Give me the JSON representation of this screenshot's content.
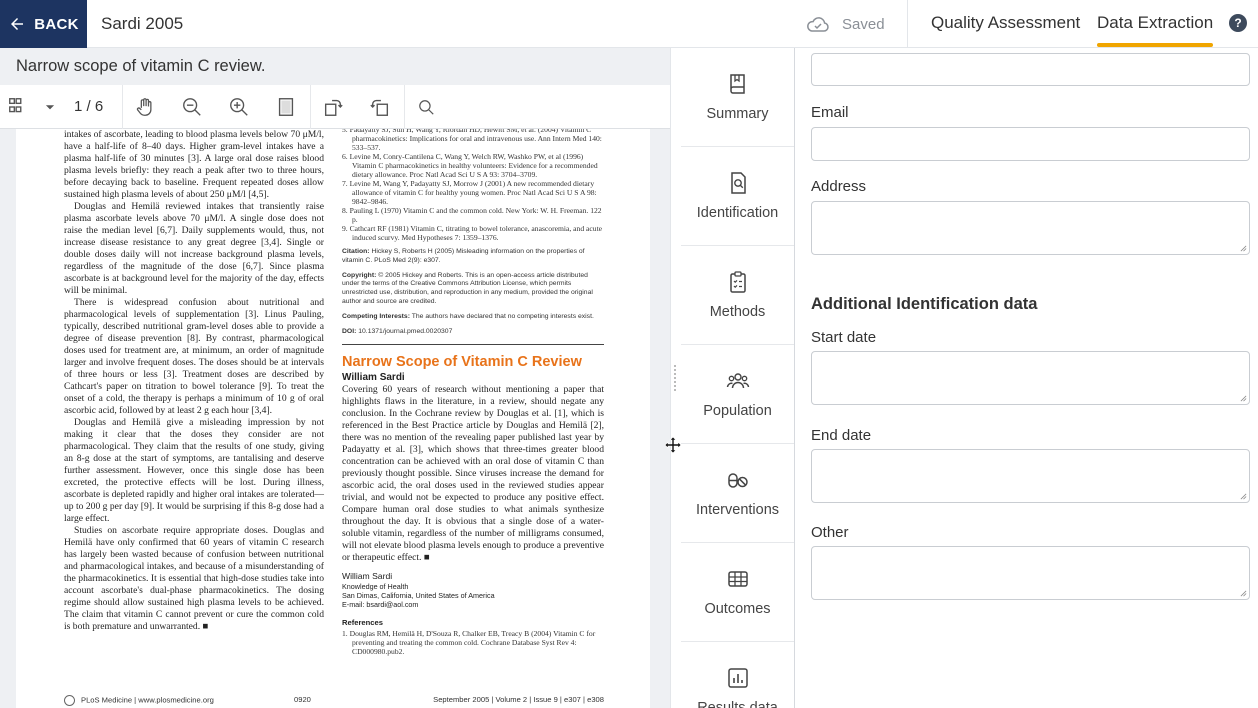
{
  "header": {
    "back_label": "BACK",
    "doc_title": "Sardi 2005",
    "saved_label": "Saved",
    "tabs": [
      {
        "label": "Quality Assessment"
      },
      {
        "label": "Data Extraction"
      }
    ],
    "help_label": "?"
  },
  "viewer": {
    "finding": "Narrow scope of vitamin C review.",
    "page_indicator": "1 / 6"
  },
  "document": {
    "col1": [
      "intakes of ascorbate, leading to blood plasma levels below 70 μM/l, have a half-life of 8–40 days. Higher gram-level intakes have a plasma half-life of 30 minutes [3]. A large oral dose raises blood plasma levels briefly: they reach a peak after two to three hours, before decaying back to baseline. Frequent repeated doses allow sustained high plasma levels of about 250 μM/l [4,5].",
      "Douglas and Hemilä reviewed intakes that transiently raise plasma ascorbate levels above 70 μM/l. A single dose does not raise the median level [6,7]. Daily supplements would, thus, not increase disease resistance to any great degree [3,4]. Single or double doses daily will not increase background plasma levels, regardless of the magnitude of the dose [6,7]. Since plasma ascorbate is at background level for the majority of the day, effects will be minimal.",
      "There is widespread confusion about nutritional and pharmacological levels of supplementation [3]. Linus Pauling, typically, described nutritional gram-level doses able to provide a degree of disease prevention [8]. By contrast, pharmacological doses used for treatment are, at minimum, an order of magnitude larger and involve frequent doses. The doses should be at intervals of three hours or less [3]. Treatment doses are described by Cathcart's paper on titration to bowel tolerance [9]. To treat the onset of a cold, the therapy is perhaps a minimum of 10 g of oral ascorbic acid, followed by at least 2 g each hour [3,4].",
      "Douglas and Hemilä give a misleading impression by not making it clear that the doses they consider are not pharmacological. They claim that the results of one study, giving an 8-g dose at the start of symptoms, are tantalising and deserve further assessment. However, once this single dose has been excreted, the protective effects will be lost. During illness, ascorbate is depleted rapidly and higher oral intakes are tolerated—up to 200 g per day [9]. It would be surprising if this 8-g dose had a large effect.",
      "Studies on ascorbate require appropriate doses. Douglas and Hemilä have only confirmed that 60 years of vitamin C research has largely been wasted because of confusion between nutritional and pharmacological intakes, and because of a misunderstanding of the pharmacokinetics. It is essential that high-dose studies take into account ascorbate's dual-phase pharmacokinetics. The dosing regime should allow sustained high plasma levels to be achieved. The claim that vitamin C cannot prevent or cure the common cold is both premature and unwarranted. ■"
    ],
    "refs_top": [
      "5.  Padayatty SJ, Sun H, Wang Y, Riordan HD, Hewitt SM, et al. (2004) Vitamin C pharmacokinetics: Implications for oral and intravenous use. Ann Intern Med 140: 533–537.",
      "6.  Levine M, Conry-Cantilena C, Wang Y, Welch RW, Washko PW, et al (1996) Vitamin C pharmacokinetics in healthy volunteers: Evidence for a recommended dietary allowance. Proc Natl Acad Sci U S A 93: 3704–3709.",
      "7.  Levine M, Wang Y, Padayatty SJ, Morrow J (2001) A new recommended dietary allowance of vitamin C for healthy young women. Proc Natl Acad Sci U S A 98: 9842–9846.",
      "8.  Pauling L (1970) Vitamin C and the common cold. New York: W. H. Freeman. 122 p.",
      "9.  Cathcart RF (1981) Vitamin C, titrating to bowel tolerance, anascoremia, and acute induced scurvy. Med Hypotheses 7: 1359–1376."
    ],
    "citation_label": "Citation:",
    "citation": " Hickey S, Roberts H (2005) Misleading information on the properties of vitamin C. PLoS Med 2(9): e307.",
    "copyright_label": "Copyright:",
    "copyright": " © 2005 Hickey and Roberts. This is an open-access article distributed under the terms of the Creative Commons Attribution License, which permits unrestricted use, distribution, and reproduction in any medium, provided the original author and source are credited.",
    "competing_label": "Competing Interests:",
    "competing": " The authors have declared that no competing interests exist.",
    "doi_label": "DOI:",
    "doi": " 10.1371/journal.pmed.0020307",
    "article_title": "Narrow Scope of Vitamin C Review",
    "article_author": "William Sardi",
    "article_body": "Covering 60 years of research without mentioning a paper that highlights flaws in the literature, in a review, should negate any conclusion. In the Cochrane review by Douglas et al. [1], which is referenced in the Best Practice article by Douglas and Hemilä [2], there was no mention of the revealing paper published last year by Padayatty et al. [3], which shows that three-times greater blood concentration can be achieved with an oral dose of vitamin C than previously thought possible. Since viruses increase the demand for ascorbic acid, the oral doses used in the reviewed studies appear trivial, and would not be expected to produce any positive effect. Compare human oral dose studies to what animals synthesize throughout the day. It is obvious that a single dose of a water-soluble vitamin, regardless of the number of milligrams consumed, will not elevate blood plasma levels enough to produce a preventive or therapeutic effect. ■",
    "addr_name": "William Sardi",
    "addr_org": "Knowledge of Health",
    "addr_city": "San Dimas, California, United States of America",
    "addr_email": "E-mail: bsardi@aol.com",
    "refs_head": "References",
    "ref1": "1.  Douglas RM, Hemilä H, D'Souza R, Chalker EB, Treacy B (2004) Vitamin C for preventing and treating the common cold. Cochrane Database Syst Rev 4: CD000980.pub2.",
    "footer_left": "PLoS Medicine  |  www.plosmedicine.org",
    "footer_mid": "0920",
    "footer_right": "September 2005  |  Volume 2  |  Issue 9  |  e307  |  e308"
  },
  "nav": {
    "items": [
      {
        "label": "Summary",
        "icon": "book-icon"
      },
      {
        "label": "Identification",
        "icon": "document-search-icon"
      },
      {
        "label": "Methods",
        "icon": "clipboard-icon"
      },
      {
        "label": "Population",
        "icon": "people-icon"
      },
      {
        "label": "Interventions",
        "icon": "pill-icon"
      },
      {
        "label": "Outcomes",
        "icon": "outcomes-icon"
      },
      {
        "label": "Results data",
        "icon": "chart-icon"
      }
    ]
  },
  "form": {
    "email_label": "Email",
    "address_label": "Address",
    "section_title": "Additional Identification data",
    "start_label": "Start date",
    "end_label": "End date",
    "other_label": "Other"
  },
  "colors": {
    "back_bg": "#1d3461",
    "tab_accent": "#f0a500",
    "article_title": "#e8731a"
  }
}
